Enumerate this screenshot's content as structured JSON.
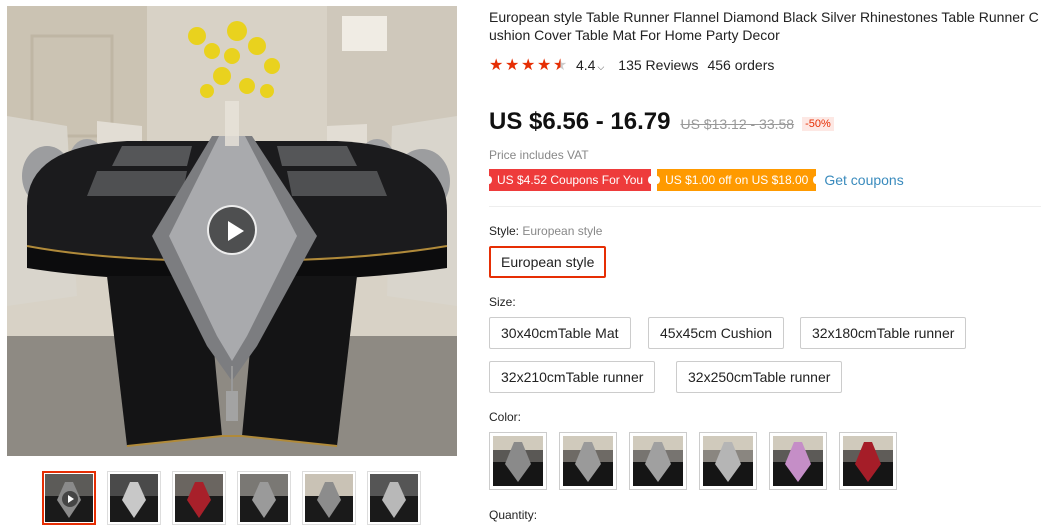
{
  "gallery": {
    "main_image": "table-runner-photo",
    "play_icon": "play-icon",
    "thumbnails": [
      {
        "name": "thumb-1",
        "active": true,
        "video": true,
        "runner": "#8a8a8a",
        "bg": "#5c5b58"
      },
      {
        "name": "thumb-2",
        "active": false,
        "video": false,
        "runner": "#c8c8c8",
        "bg": "#4a4a4a"
      },
      {
        "name": "thumb-3",
        "active": false,
        "video": false,
        "runner": "#a8202a",
        "bg": "#6a6560"
      },
      {
        "name": "thumb-4",
        "active": false,
        "video": false,
        "runner": "#9a9a9a",
        "bg": "#7a7874"
      },
      {
        "name": "thumb-5",
        "active": false,
        "video": false,
        "runner": "#8c8c8c",
        "bg": "#c9c2b5"
      },
      {
        "name": "thumb-6",
        "active": false,
        "video": false,
        "runner": "#b8b8b8",
        "bg": "#555"
      }
    ]
  },
  "product": {
    "title": "European style Table Runner Flannel Diamond Black Silver Rhinestones Table Runner Cushion Cover Table Mat For Home Party Decor",
    "rating": "4.4",
    "reviews": "135 Reviews",
    "orders": "456 orders",
    "price": "US $6.56 - 16.79",
    "original_price": "US $13.12 - 33.58",
    "discount": "-50%",
    "vat_note": "Price includes VAT"
  },
  "coupons": {
    "red": "US $4.52 Coupons For You",
    "orange": "US $1.00 off on US $18.00",
    "link": "Get coupons"
  },
  "style": {
    "label": "Style: ",
    "value": "European style",
    "options": [
      "European style"
    ]
  },
  "size": {
    "label": "Size:",
    "options": [
      "30x40cmTable Mat",
      "45x45cm Cushion",
      "32x180cmTable runner",
      "32x210cmTable runner",
      "32x250cmTable runner"
    ]
  },
  "color": {
    "label": "Color:",
    "swatches": [
      {
        "name": "color-swatch-1",
        "runner": "#8a8a8a",
        "bg": "#5a5855"
      },
      {
        "name": "color-swatch-2",
        "runner": "#9a9a9a",
        "bg": "#6e6a65"
      },
      {
        "name": "color-swatch-3",
        "runner": "#a0a0a0",
        "bg": "#777470"
      },
      {
        "name": "color-swatch-4",
        "runner": "#b5b5b5",
        "bg": "#8a8680"
      },
      {
        "name": "color-swatch-5",
        "runner": "#c58ec7",
        "bg": "#5c5a57"
      },
      {
        "name": "color-swatch-6",
        "runner": "#a51d28",
        "bg": "#5f5c58"
      }
    ]
  },
  "quantity": {
    "label": "Quantity:"
  },
  "colors": {
    "accent": "#e62e04",
    "coupon_red": "#ee3b3b",
    "coupon_orange": "#ff9a00",
    "link": "#3a8bbd"
  }
}
